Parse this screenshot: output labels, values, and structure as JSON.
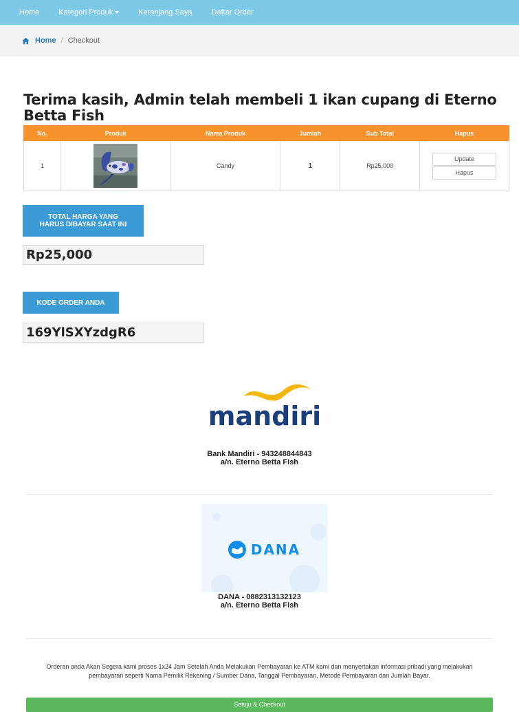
{
  "nav": {
    "items": [
      "Home",
      "Kategori Produk",
      "Keranjang Saya",
      "Daftar Order"
    ]
  },
  "breadcrumb": {
    "home": "Home",
    "separator": "/",
    "current": "Checkout"
  },
  "title": "Terima kasih, Admin telah membeli 1 ikan cupang di Eterno Betta Fish",
  "table": {
    "headers": [
      "No.",
      "Produk",
      "Nama Produk",
      "Jumlah",
      "Sub Total",
      "Hapus"
    ],
    "rows": [
      {
        "no": "1",
        "name": "Candy",
        "qty": "1",
        "subtotal": "Rp25,000",
        "update_label": "Update",
        "hapus_label": "Hapus"
      }
    ]
  },
  "total": {
    "label": "TOTAL HARGA YANG HARUS DIBAYAR SAAT INI",
    "value": "Rp25,000"
  },
  "order_code": {
    "label": "KODE ORDER ANDA",
    "value": "169YlSXYzdgR6"
  },
  "banks": {
    "mandiri": {
      "logo_text": "mandiri",
      "line1": "Bank Mandiri - 943248844843",
      "line2": "a/n. Eterno Betta Fish"
    },
    "dana": {
      "logo_text": "DANA",
      "line1": "DANA - 0882313132123",
      "line2": "a/n. Eterno Betta Fish"
    }
  },
  "notice": "Orderan anda Akan Segera kami proses 1x24 Jam Setelah Anda Melakukan Pembayaran ke ATM kami dan menyertakan informasi pribadi yang melakukan pembayaran seperti Nama Pemilik Rekening / Sumber Dana, Tanggal Pembayaran, Metode Pembayaran dan Jumlah Bayar.",
  "checkout_button": "Setuju & Checkout",
  "colors": {
    "navbar": "#7ec8e8",
    "table_header": "#f6932c",
    "label_blue": "#3b9bd6",
    "checkout_green": "#5cb85c",
    "mandiri_blue": "#1a3f7a",
    "mandiri_gold": "#f5b50f",
    "dana_blue": "#118eea"
  },
  "icons": {
    "breadcrumb_home": "home-icon",
    "nav_dropdown": "caret-down-icon"
  }
}
